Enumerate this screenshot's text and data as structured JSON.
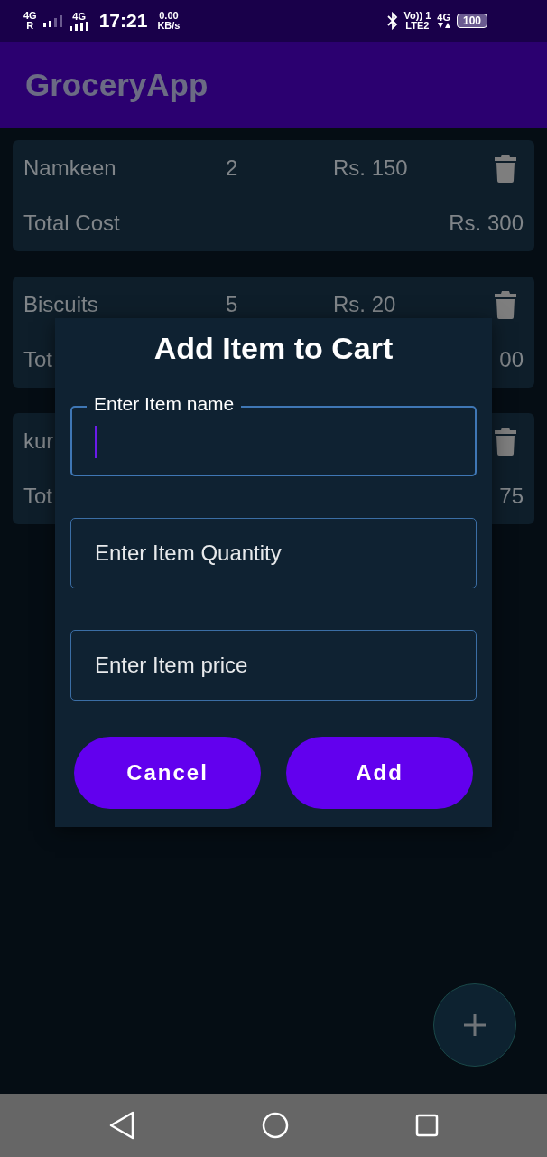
{
  "status_bar": {
    "sim1": "4G",
    "sim1_roaming": "R",
    "sim2": "4G",
    "time": "17:21",
    "speed": "0.00",
    "speed_unit": "KB/s",
    "volte": "Vo))",
    "volte_sim": "1",
    "lte": "LTE2",
    "data": "4G",
    "battery": "100"
  },
  "app_bar": {
    "title": "GroceryApp"
  },
  "cart_items": [
    {
      "name": "Namkeen",
      "quantity": "2",
      "price": "Rs. 150",
      "total_label": "Total Cost",
      "total": "Rs. 300"
    },
    {
      "name": "Biscuits",
      "quantity": "5",
      "price": "Rs. 20",
      "total_label": "Tot",
      "total": "00"
    },
    {
      "name": "kur",
      "total_label": "Tot",
      "total": "75"
    }
  ],
  "dialog": {
    "title": "Add Item to Cart",
    "fields": [
      {
        "label": "Enter Item name",
        "focused": true
      },
      {
        "placeholder": "Enter Item Quantity",
        "focused": false
      },
      {
        "placeholder": "Enter Item price",
        "focused": false
      }
    ],
    "buttons": [
      "Cancel",
      "Add"
    ]
  }
}
